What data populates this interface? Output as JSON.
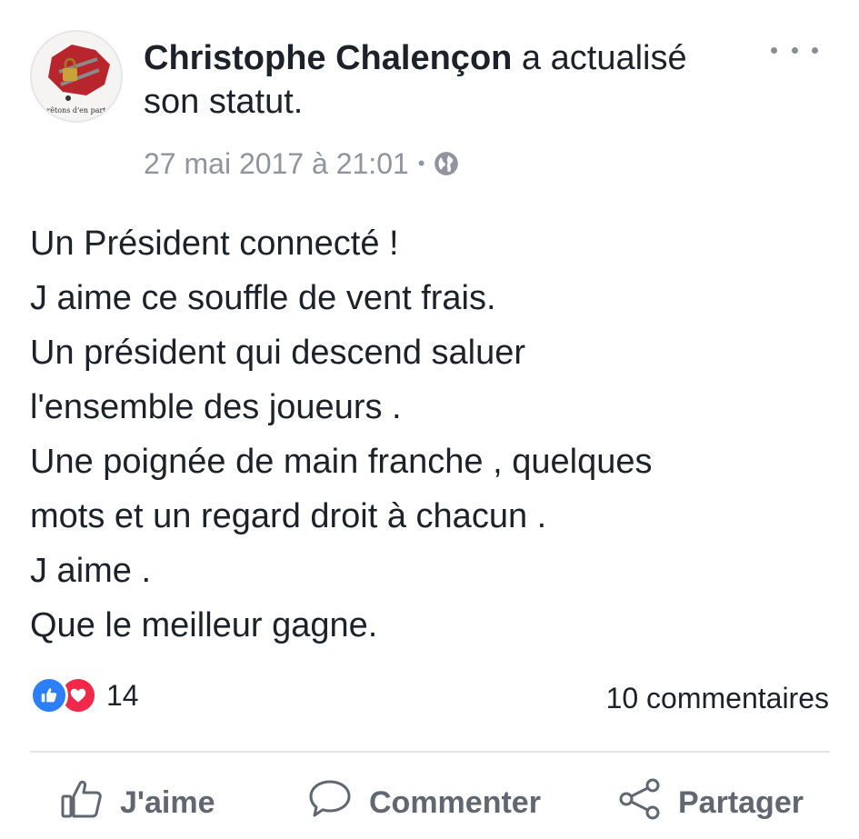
{
  "post": {
    "author": "Christophe Chalençon",
    "action_text": " a actualisé son statut.",
    "timestamp": "27 mai 2017 à 21:01",
    "separator": "•",
    "avatar_caption": "rêtons d'en part",
    "lines": [
      "Un Président connecté !",
      "J aime ce souffle de vent frais.",
      "Un président qui descend saluer",
      "l'ensemble des joueurs .",
      "Une poignée de main franche , quelques",
      "mots et un regard droit à chacun .",
      "J aime .",
      "Que le meilleur gagne."
    ]
  },
  "stats": {
    "reaction_count": "14",
    "comments": "10 commentaires"
  },
  "actions": {
    "like_label": "J'aime",
    "comment_label": "Commenter",
    "share_label": "Partager"
  },
  "icons": {
    "avatar": "map-chain-avatar",
    "privacy": "globe-icon",
    "more": "more-icon",
    "like_reaction": "like-reaction-icon",
    "love_reaction": "love-reaction-icon",
    "like_action": "thumbs-up-icon",
    "comment_action": "speech-bubble-icon",
    "share_action": "share-icon"
  },
  "colors": {
    "text": "#1d2129",
    "meta": "#90949c",
    "action": "#606770",
    "like_blue": "#2d7ff9",
    "love_red": "#f0284a"
  }
}
